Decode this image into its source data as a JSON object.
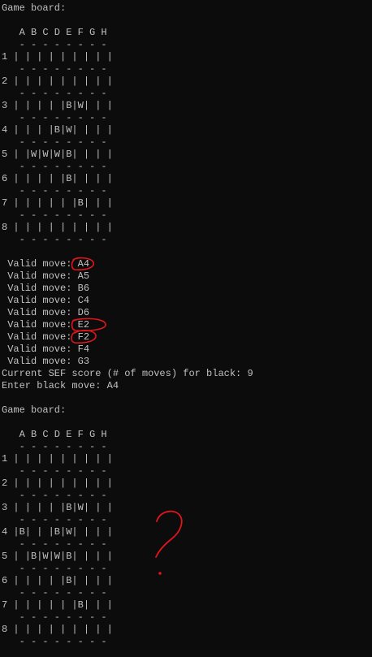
{
  "terminal": {
    "colors": {
      "background": "#0c0c0c",
      "text": "#c0c0c0",
      "annotation": "#e0161b"
    },
    "lines": [
      "Game board:",
      "",
      "   A B C D E F G H",
      "   - - - - - - - -",
      "1 | | | | | | | | |",
      "   - - - - - - - -",
      "2 | | | | | | | | |",
      "   - - - - - - - -",
      "3 | | | | |B|W| | |",
      "   - - - - - - - -",
      "4 | | | |B|W| | | |",
      "   - - - - - - - -",
      "5 | |W|W|W|B| | | |",
      "   - - - - - - - -",
      "6 | | | | |B| | | |",
      "   - - - - - - - -",
      "7 | | | | | |B| | |",
      "   - - - - - - - -",
      "8 | | | | | | | | |",
      "   - - - - - - - -",
      "",
      " Valid move: A4",
      " Valid move: A5",
      " Valid move: B6",
      " Valid move: C4",
      " Valid move: D6",
      " Valid move: E2",
      " Valid move: F2",
      " Valid move: F4",
      " Valid move: G3",
      "Current SEF score (# of moves) for black: 9",
      "Enter black move: A4",
      "",
      "Game board:",
      "",
      "   A B C D E F G H",
      "   - - - - - - - -",
      "1 | | | | | | | | |",
      "   - - - - - - - -",
      "2 | | | | | | | | |",
      "   - - - - - - - -",
      "3 | | | | |B|W| | |",
      "   - - - - - - - -",
      "4 |B| | |B|W| | | |",
      "   - - - - - - - -",
      "5 | |B|W|W|B| | | |",
      "   - - - - - - - -",
      "6 | | | | |B| | | |",
      "   - - - - - - - -",
      "7 | | | | | |B| | |",
      "   - - - - - - - -",
      "8 | | | | | | | | |",
      "   - - - - - - - -"
    ]
  }
}
